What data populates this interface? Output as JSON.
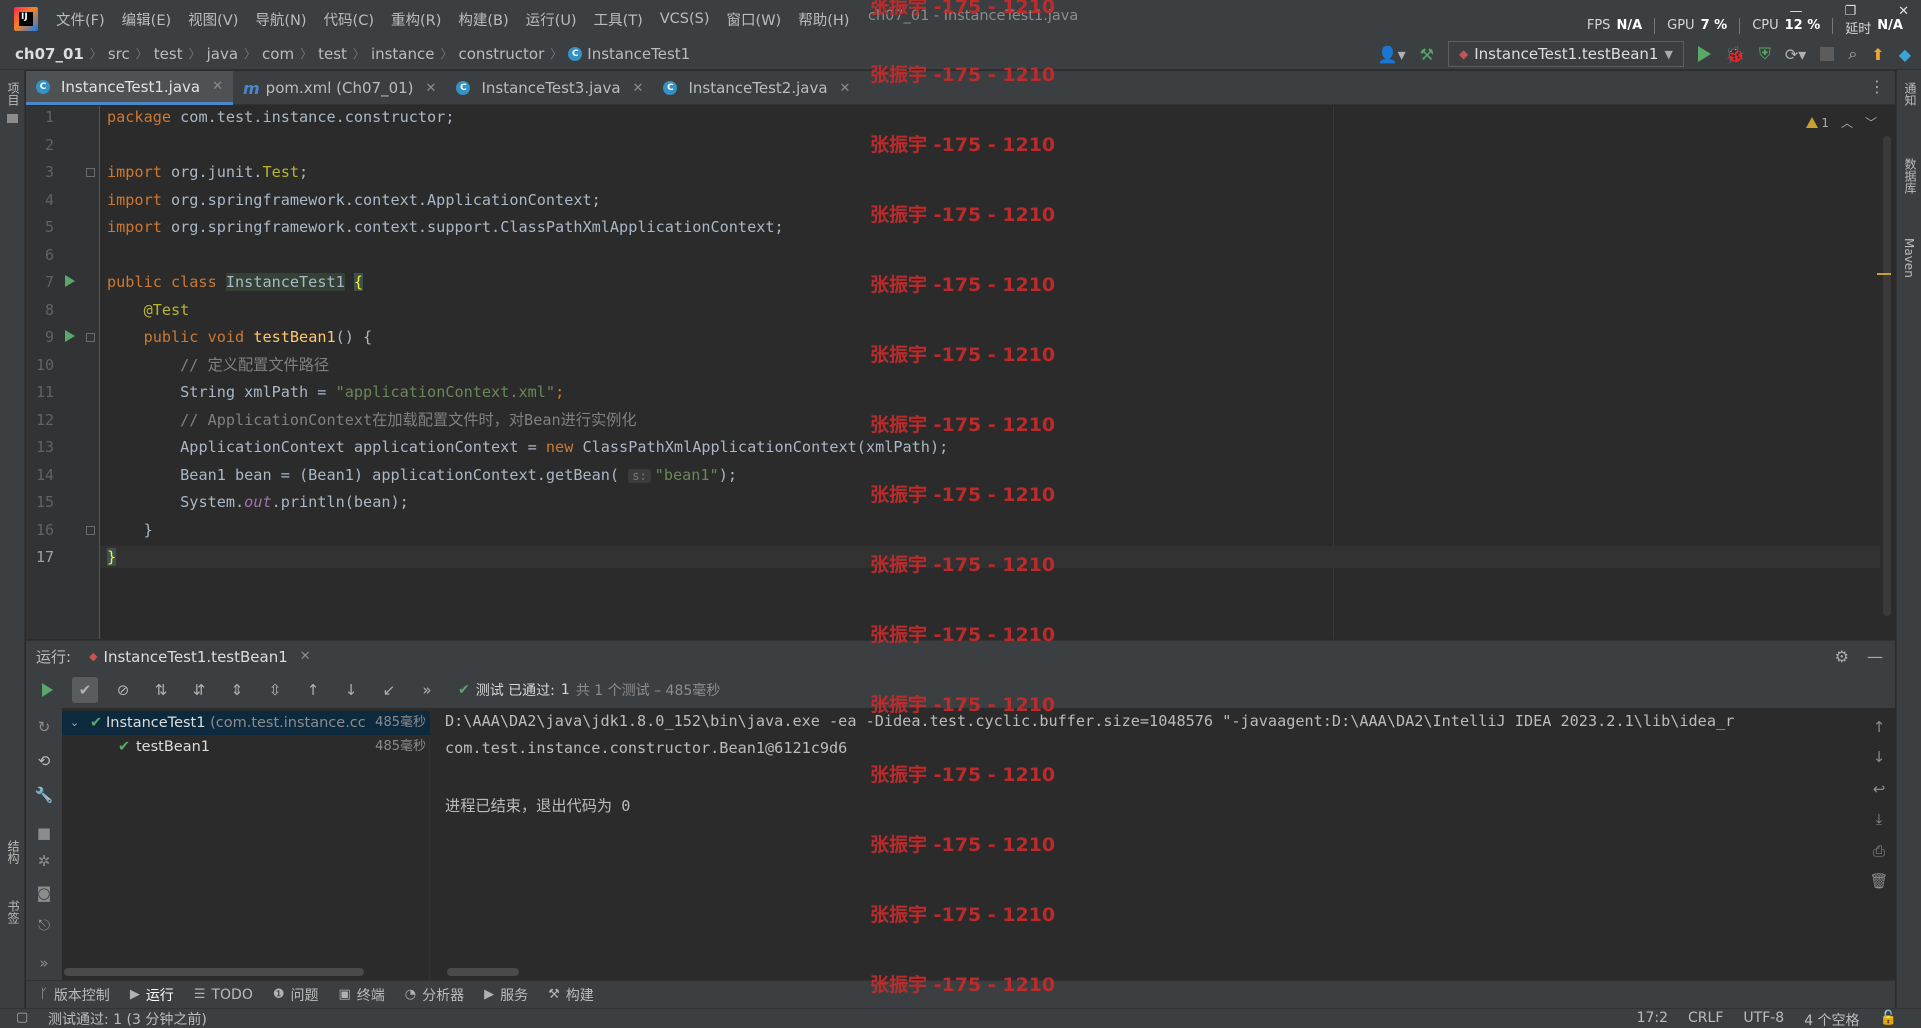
{
  "window": {
    "title": "ch07_01 - InstanceTest1.java",
    "perf": {
      "fps_label": "FPS",
      "fps_value": "N/A",
      "gpu_label": "GPU",
      "gpu_value": "7 %",
      "cpu_label": "CPU",
      "cpu_value": "12 %",
      "latency_label": "延时",
      "latency_value": "N/A"
    }
  },
  "menu": [
    "文件(F)",
    "编辑(E)",
    "视图(V)",
    "导航(N)",
    "代码(C)",
    "重构(R)",
    "构建(B)",
    "运行(U)",
    "工具(T)",
    "VCS(S)",
    "窗口(W)",
    "帮助(H)"
  ],
  "breadcrumb": [
    "ch07_01",
    "src",
    "test",
    "java",
    "com",
    "test",
    "instance",
    "constructor",
    "InstanceTest1"
  ],
  "run_config": {
    "label": "InstanceTest1.testBean1"
  },
  "side_labels": {
    "project": "项目",
    "structure": "结构",
    "bookmarks": "书签",
    "notifications": "通知",
    "database": "数据库",
    "maven": "Maven"
  },
  "tabs": [
    {
      "label": "InstanceTest1.java",
      "icon": "class-icon",
      "active": true
    },
    {
      "label": "pom.xml (Ch07_01)",
      "icon": "maven-icon",
      "active": false
    },
    {
      "label": "InstanceTest3.java",
      "icon": "class-icon",
      "active": false
    },
    {
      "label": "InstanceTest2.java",
      "icon": "class-icon",
      "active": false
    }
  ],
  "editor": {
    "warning_count": "1",
    "line_numbers": [
      "1",
      "2",
      "3",
      "4",
      "5",
      "6",
      "7",
      "8",
      "9",
      "10",
      "11",
      "12",
      "13",
      "14",
      "15",
      "16",
      "17"
    ],
    "current_line": 17,
    "code": {
      "l1_kw": "package",
      "l1_rest": " com.test.instance.constructor;",
      "l3_kw": "import",
      "l3_rest": " org.junit.",
      "l3_cls": "Test",
      "l3_end": ";",
      "l4_kw": "import",
      "l4_rest": " org.springframework.context.ApplicationContext;",
      "l5_kw": "import",
      "l5_rest": " org.springframework.context.support.ClassPathXmlApplicationContext;",
      "l7_kw": "public class",
      "l7_name": "InstanceTest1",
      "l7_brace": "{",
      "l8_ann": "@Test",
      "l9_kw": "public void",
      "l9_fn": "testBean1",
      "l9_rest": "() {",
      "l10_cmt": "// 定义配置文件路径",
      "l11_pre": "String xmlPath = ",
      "l11_str": "\"applicationContext.xml\"",
      "l11_end": ";",
      "l12_cmt": "// ApplicationContext在加载配置文件时，对Bean进行实例化",
      "l13_pre": "ApplicationContext applicationContext = ",
      "l13_kw": "new",
      "l13_rest": " ClassPathXmlApplicationContext(xmlPath);",
      "l14_pre": "Bean1 bean = (Bean1) applicationContext.getBean(",
      "l14_hint": "s:",
      "l14_str": "\"bean1\"",
      "l14_end": ");",
      "l15_pre": "System.",
      "l15_fld": "out",
      "l15_rest": ".println(bean);",
      "l16": "}",
      "l17": "}"
    }
  },
  "run_panel": {
    "label": "运行:",
    "tab": "InstanceTest1.testBean1",
    "status_prefix": "测试 已通过:",
    "status_count": "1",
    "status_detail": "共 1 个测试 – 485毫秒",
    "tree": [
      {
        "name": "InstanceTest1",
        "pkg": "(com.test.instance.cc",
        "time": "485毫秒"
      },
      {
        "name": "testBean1",
        "pkg": "",
        "time": "485毫秒"
      }
    ],
    "console": [
      "D:\\AAA\\DA2\\java\\jdk1.8.0_152\\bin\\java.exe -ea -Didea.test.cyclic.buffer.size=1048576 \"-javaagent:D:\\AAA\\DA2\\IntelliJ IDEA 2023.2.1\\lib\\idea_r",
      "com.test.instance.constructor.Bean1@6121c9d6",
      "",
      "进程已结束，退出代码为 0"
    ]
  },
  "tool_windows": [
    "版本控制",
    "运行",
    "TODO",
    "问题",
    "终端",
    "分析器",
    "服务",
    "构建"
  ],
  "status_bar": {
    "message": "测试通过: 1 (3 分钟之前)",
    "position": "17:2",
    "line_sep": "CRLF",
    "encoding": "UTF-8",
    "indent": "4 个空格"
  },
  "watermark": "张振宇 -175 - 1210",
  "colors": {
    "accent": "#4a88c7",
    "run_green": "#59a869",
    "watermark": "#c42b2b"
  }
}
